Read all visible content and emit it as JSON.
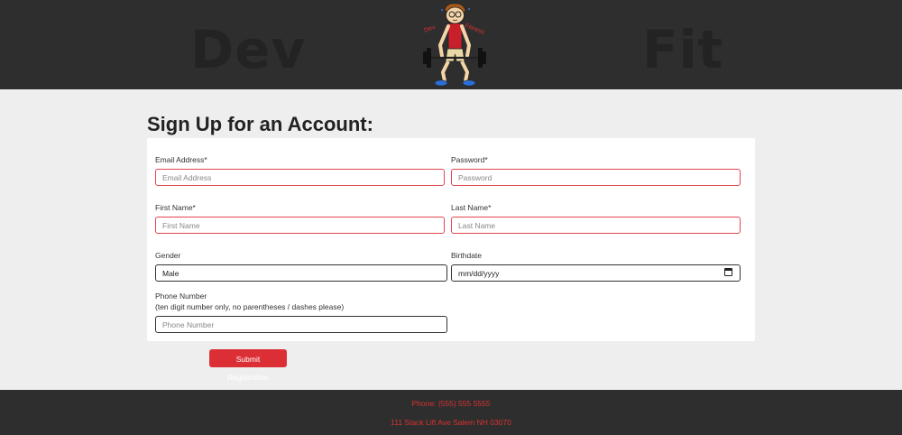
{
  "header": {
    "brand_left": "Dev",
    "brand_right": "Fit",
    "logo_text_left": "Dev",
    "logo_text_right": "Fitness",
    "logo_icon": "weightlifter-mascot-logo"
  },
  "page": {
    "title": "Sign Up for an Account:"
  },
  "form": {
    "email": {
      "label": "Email Address*",
      "placeholder": "Email Address"
    },
    "password": {
      "label": "Password*",
      "placeholder": "Password"
    },
    "first_name": {
      "label": "First Name*",
      "placeholder": "First Name"
    },
    "last_name": {
      "label": "Last Name*",
      "placeholder": "Last Name"
    },
    "gender": {
      "label": "Gender",
      "value": "Male",
      "icon": "chevron-down-icon"
    },
    "birthdate": {
      "label": "Birthdate",
      "placeholder": "mm/dd/yyyy",
      "icon": "calendar-icon"
    },
    "phone": {
      "label": "Phone Number",
      "hint": "(ten digit number only, no parentheses / dashes please)",
      "placeholder": "Phone Number"
    },
    "submit_label": "Submit Registration"
  },
  "footer": {
    "phone": "Phone: (555) 555 5555",
    "address": "111 Stack Lift Ave Salem NH 03070"
  },
  "colors": {
    "header_bg": "#2e2e2e",
    "accent_red": "#dc2f35",
    "invalid_border": "#e0474f",
    "page_bg": "#eeeeee"
  }
}
